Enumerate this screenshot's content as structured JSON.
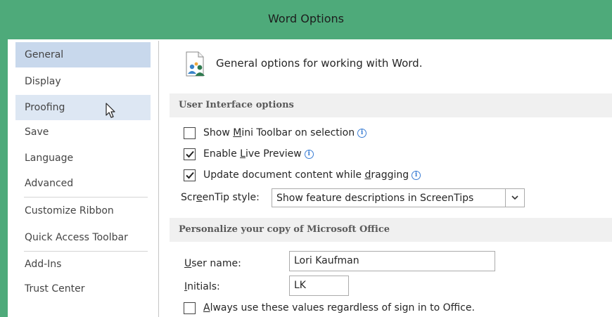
{
  "window": {
    "title": "Word Options"
  },
  "sidebar": {
    "items": [
      {
        "label": "General"
      },
      {
        "label": "Display"
      },
      {
        "label": "Proofing"
      },
      {
        "label": "Save"
      },
      {
        "label": "Language"
      },
      {
        "label": "Advanced"
      },
      {
        "label": "Customize Ribbon"
      },
      {
        "label": "Quick Access Toolbar"
      },
      {
        "label": "Add-Ins"
      },
      {
        "label": "Trust Center"
      }
    ],
    "selected": "General",
    "hovered": "Proofing"
  },
  "header": {
    "icon": "general-options-icon",
    "text": "General options for working with Word."
  },
  "ui_options": {
    "section_title": "User Interface options",
    "mini_toolbar": {
      "pre": "Show ",
      "key": "M",
      "post": "ini Toolbar on selection",
      "checked": false
    },
    "live_preview": {
      "pre": "Enable ",
      "key": "L",
      "post": "ive Preview",
      "checked": true
    },
    "update_dragging": {
      "pre": "Update document content while ",
      "key": "d",
      "post": "ragging",
      "checked": true
    },
    "screentip": {
      "pre": "Scr",
      "key": "e",
      "post": "enTip style:",
      "value": "Show feature descriptions in ScreenTips"
    }
  },
  "personalize": {
    "section_title": "Personalize your copy of Microsoft Office",
    "user_name": {
      "key": "U",
      "post": "ser name:",
      "value": "Lori Kaufman"
    },
    "initials": {
      "key": "I",
      "post": "nitials:",
      "value": "LK"
    },
    "always_use": {
      "key": "A",
      "post": "lways use these values regardless of sign in to Office.",
      "checked": false
    }
  },
  "colors": {
    "title_bar": "#4eaa7a",
    "selected_item": "#c8d8ec",
    "hover_item": "#dde7f3",
    "info_icon": "#3a7dd4"
  }
}
